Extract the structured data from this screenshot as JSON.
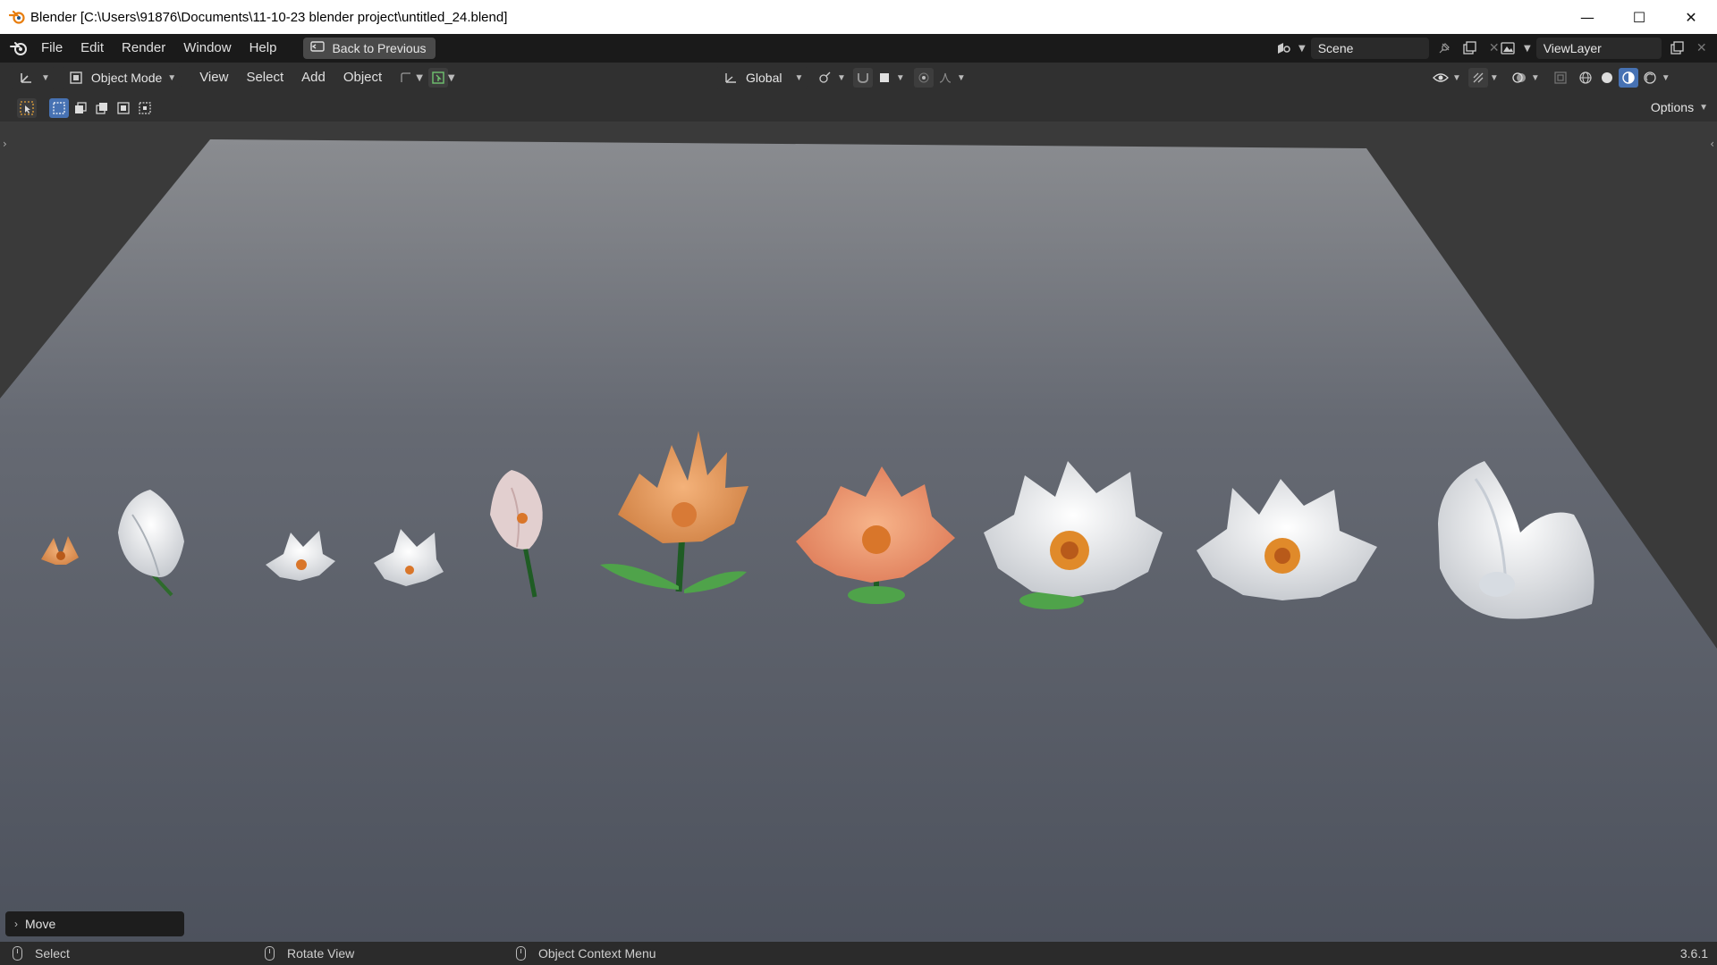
{
  "window": {
    "title": "Blender [C:\\Users\\91876\\Documents\\11-10-23 blender project\\untitled_24.blend]",
    "minimize": "—",
    "maximize": "☐",
    "close": "✕"
  },
  "menu": {
    "items": [
      "File",
      "Edit",
      "Render",
      "Window",
      "Help"
    ],
    "back_to_previous": "Back to Previous"
  },
  "scene": {
    "name": "Scene"
  },
  "view_layer": {
    "name": "ViewLayer"
  },
  "header": {
    "mode": "Object Mode",
    "menus": [
      "View",
      "Select",
      "Add",
      "Object"
    ],
    "transform_orientation": "Global"
  },
  "tool_header": {
    "options_label": "Options"
  },
  "viewport": {
    "last_operator": "Move",
    "flowers": [
      {
        "label": "orange-bud",
        "color": "#d98a3e"
      },
      {
        "label": "white-closed-bud",
        "color": "#c9d0d6"
      },
      {
        "label": "white-small-1",
        "color": "#f2f2f2"
      },
      {
        "label": "white-small-2",
        "color": "#f2f2f2"
      },
      {
        "label": "pink-half-open",
        "color": "#d9c2c2"
      },
      {
        "label": "orange-tall",
        "color": "#e09a5c"
      },
      {
        "label": "salmon-open",
        "color": "#e8926b"
      },
      {
        "label": "white-open-1",
        "color": "#f0f0f0"
      },
      {
        "label": "white-open-2",
        "color": "#f0f0f0"
      },
      {
        "label": "white-large",
        "color": "#e6e9ee"
      }
    ]
  },
  "statusbar": {
    "select": "Select",
    "rotate": "Rotate View",
    "context": "Object Context Menu",
    "version": "3.6.1"
  },
  "colors": {
    "accent": "#4772b3",
    "viewport_bg": "#3a3a3a",
    "plane": "#6b6f78"
  }
}
